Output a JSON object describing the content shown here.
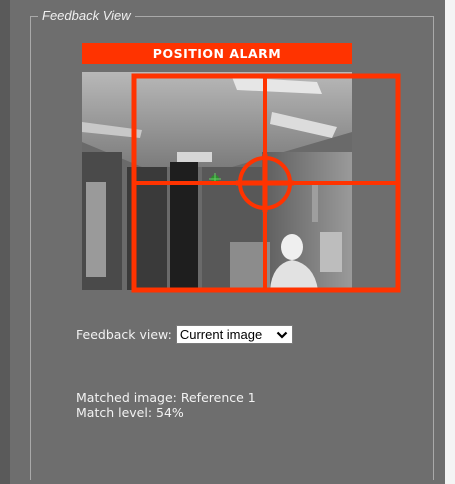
{
  "panel": {
    "title": "Feedback View"
  },
  "alarm": {
    "label": "POSITION ALARM",
    "color": "#ff3300"
  },
  "feedback_view": {
    "label": "Feedback view:",
    "selected_option": "Current image"
  },
  "match": {
    "matched_image_text": "Matched image: Reference 1",
    "match_level_text": "Match level: 54%"
  },
  "icons": {
    "select_toggle": "chevron-down-icon",
    "target_reticle": "crosshair-icon",
    "detection_marker": "marker-icon"
  }
}
